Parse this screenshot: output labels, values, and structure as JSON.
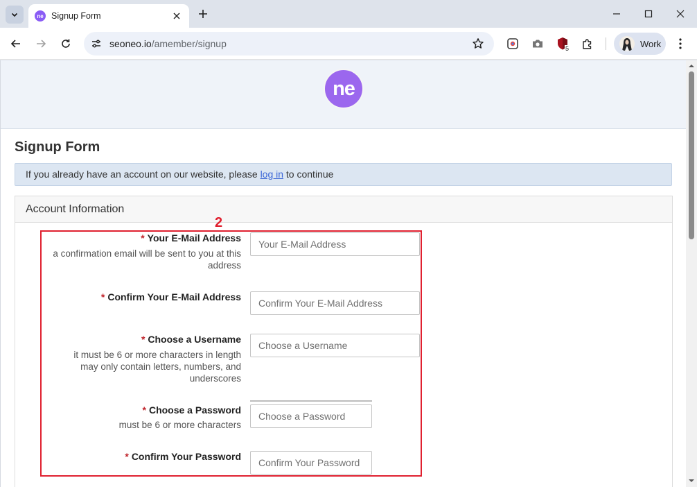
{
  "browser": {
    "tab_title": "Signup Form",
    "url_host": "seoneo.io",
    "url_path": "/amember/signup",
    "profile_label": "Work",
    "extension_badge": "5"
  },
  "page": {
    "logo_text": "ne",
    "heading": "Signup Form",
    "notice_prefix": "If you already have an account on our website, please ",
    "notice_link": "log in",
    "notice_suffix": " to continue",
    "section_title": "Account Information"
  },
  "form": {
    "fields": [
      {
        "label": "Your E-Mail Address",
        "hint": "a confirmation email will be sent to you at this address",
        "placeholder": "Your E-Mail Address"
      },
      {
        "label": "Confirm Your E-Mail Address",
        "hint": "",
        "placeholder": "Confirm Your E-Mail Address"
      },
      {
        "label": "Choose a Username",
        "hint": "it must be 6 or more characters in length may only contain letters, numbers, and underscores",
        "placeholder": "Choose a Username"
      },
      {
        "label": "Choose a Password",
        "hint": "must be 6 or more characters",
        "placeholder": "Choose a Password"
      },
      {
        "label": "Confirm Your Password",
        "hint": "",
        "placeholder": "Confirm Your Password"
      }
    ],
    "required_marker": "*"
  },
  "annotation": {
    "number": "2",
    "color": "#e0202f"
  },
  "colors": {
    "accent": "#9b67ee",
    "link": "#3b66d6",
    "required": "#c0242b"
  }
}
